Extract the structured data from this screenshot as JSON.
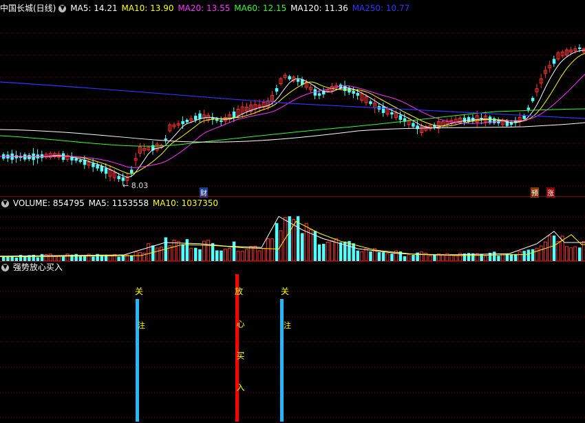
{
  "price_panel": {
    "stock_title": "中国长城(日线)",
    "indicators": [
      {
        "label": "MA5: 14.21",
        "color": "#ffffff"
      },
      {
        "label": "MA10: 13.90",
        "color": "#ffff00"
      },
      {
        "label": "MA20: 13.55",
        "color": "#ff33ff"
      },
      {
        "label": "MA60: 12.15",
        "color": "#33ff33"
      },
      {
        "label": "MA120: 11.36",
        "color": "#ffffff"
      },
      {
        "label": "MA250: 10.77",
        "color": "#3333ff"
      }
    ],
    "low_marker": "← 8.03",
    "badges": {
      "finance": "财",
      "forecast": "预",
      "limit_up": "涨"
    }
  },
  "volume_panel": {
    "indicators": [
      {
        "label": "VOLUME: 854795",
        "color": "#ffffff"
      },
      {
        "label": "MA5: 1153558",
        "color": "#ffffff"
      },
      {
        "label": "MA10: 1037350",
        "color": "#ffff00"
      }
    ]
  },
  "signal_panel": {
    "title": "强势放心买入",
    "signals": [
      {
        "label": "关",
        "sub": "注",
        "color": "#29b6f6"
      },
      {
        "label": "放",
        "sub": "心买入",
        "color": "#ff0000"
      },
      {
        "label": "关",
        "sub": "注",
        "color": "#29b6f6"
      }
    ]
  },
  "colors": {
    "up": "#ff3333",
    "down": "#54ffff",
    "grid": "#8b0000",
    "background": "#000000"
  },
  "chart_data": {
    "type": "candlestick",
    "series": [
      {
        "name": "MA5",
        "values": [
          14.21
        ]
      },
      {
        "name": "MA10",
        "values": [
          13.9
        ]
      },
      {
        "name": "MA20",
        "values": [
          13.55
        ]
      },
      {
        "name": "MA60",
        "values": [
          12.15
        ]
      },
      {
        "name": "MA120",
        "values": [
          11.36
        ]
      },
      {
        "name": "MA250",
        "values": [
          10.77
        ]
      },
      {
        "name": "VOLUME",
        "values": [
          854795
        ]
      },
      {
        "name": "VOL MA5",
        "values": [
          1153558
        ]
      },
      {
        "name": "VOL MA10",
        "values": [
          1037350
        ]
      }
    ],
    "annotations": [
      "8.03"
    ]
  }
}
